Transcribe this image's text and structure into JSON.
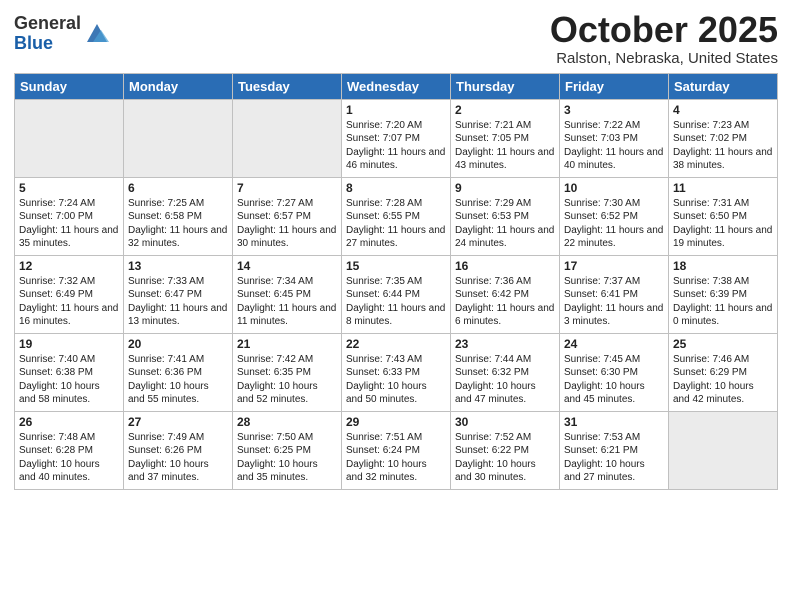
{
  "header": {
    "logo_general": "General",
    "logo_blue": "Blue",
    "month": "October 2025",
    "location": "Ralston, Nebraska, United States"
  },
  "days_of_week": [
    "Sunday",
    "Monday",
    "Tuesday",
    "Wednesday",
    "Thursday",
    "Friday",
    "Saturday"
  ],
  "weeks": [
    [
      {
        "day": "",
        "content": ""
      },
      {
        "day": "",
        "content": ""
      },
      {
        "day": "",
        "content": ""
      },
      {
        "day": "1",
        "content": "Sunrise: 7:20 AM\nSunset: 7:07 PM\nDaylight: 11 hours\nand 46 minutes."
      },
      {
        "day": "2",
        "content": "Sunrise: 7:21 AM\nSunset: 7:05 PM\nDaylight: 11 hours\nand 43 minutes."
      },
      {
        "day": "3",
        "content": "Sunrise: 7:22 AM\nSunset: 7:03 PM\nDaylight: 11 hours\nand 40 minutes."
      },
      {
        "day": "4",
        "content": "Sunrise: 7:23 AM\nSunset: 7:02 PM\nDaylight: 11 hours\nand 38 minutes."
      }
    ],
    [
      {
        "day": "5",
        "content": "Sunrise: 7:24 AM\nSunset: 7:00 PM\nDaylight: 11 hours\nand 35 minutes."
      },
      {
        "day": "6",
        "content": "Sunrise: 7:25 AM\nSunset: 6:58 PM\nDaylight: 11 hours\nand 32 minutes."
      },
      {
        "day": "7",
        "content": "Sunrise: 7:27 AM\nSunset: 6:57 PM\nDaylight: 11 hours\nand 30 minutes."
      },
      {
        "day": "8",
        "content": "Sunrise: 7:28 AM\nSunset: 6:55 PM\nDaylight: 11 hours\nand 27 minutes."
      },
      {
        "day": "9",
        "content": "Sunrise: 7:29 AM\nSunset: 6:53 PM\nDaylight: 11 hours\nand 24 minutes."
      },
      {
        "day": "10",
        "content": "Sunrise: 7:30 AM\nSunset: 6:52 PM\nDaylight: 11 hours\nand 22 minutes."
      },
      {
        "day": "11",
        "content": "Sunrise: 7:31 AM\nSunset: 6:50 PM\nDaylight: 11 hours\nand 19 minutes."
      }
    ],
    [
      {
        "day": "12",
        "content": "Sunrise: 7:32 AM\nSunset: 6:49 PM\nDaylight: 11 hours\nand 16 minutes."
      },
      {
        "day": "13",
        "content": "Sunrise: 7:33 AM\nSunset: 6:47 PM\nDaylight: 11 hours\nand 13 minutes."
      },
      {
        "day": "14",
        "content": "Sunrise: 7:34 AM\nSunset: 6:45 PM\nDaylight: 11 hours\nand 11 minutes."
      },
      {
        "day": "15",
        "content": "Sunrise: 7:35 AM\nSunset: 6:44 PM\nDaylight: 11 hours\nand 8 minutes."
      },
      {
        "day": "16",
        "content": "Sunrise: 7:36 AM\nSunset: 6:42 PM\nDaylight: 11 hours\nand 6 minutes."
      },
      {
        "day": "17",
        "content": "Sunrise: 7:37 AM\nSunset: 6:41 PM\nDaylight: 11 hours\nand 3 minutes."
      },
      {
        "day": "18",
        "content": "Sunrise: 7:38 AM\nSunset: 6:39 PM\nDaylight: 11 hours\nand 0 minutes."
      }
    ],
    [
      {
        "day": "19",
        "content": "Sunrise: 7:40 AM\nSunset: 6:38 PM\nDaylight: 10 hours\nand 58 minutes."
      },
      {
        "day": "20",
        "content": "Sunrise: 7:41 AM\nSunset: 6:36 PM\nDaylight: 10 hours\nand 55 minutes."
      },
      {
        "day": "21",
        "content": "Sunrise: 7:42 AM\nSunset: 6:35 PM\nDaylight: 10 hours\nand 52 minutes."
      },
      {
        "day": "22",
        "content": "Sunrise: 7:43 AM\nSunset: 6:33 PM\nDaylight: 10 hours\nand 50 minutes."
      },
      {
        "day": "23",
        "content": "Sunrise: 7:44 AM\nSunset: 6:32 PM\nDaylight: 10 hours\nand 47 minutes."
      },
      {
        "day": "24",
        "content": "Sunrise: 7:45 AM\nSunset: 6:30 PM\nDaylight: 10 hours\nand 45 minutes."
      },
      {
        "day": "25",
        "content": "Sunrise: 7:46 AM\nSunset: 6:29 PM\nDaylight: 10 hours\nand 42 minutes."
      }
    ],
    [
      {
        "day": "26",
        "content": "Sunrise: 7:48 AM\nSunset: 6:28 PM\nDaylight: 10 hours\nand 40 minutes."
      },
      {
        "day": "27",
        "content": "Sunrise: 7:49 AM\nSunset: 6:26 PM\nDaylight: 10 hours\nand 37 minutes."
      },
      {
        "day": "28",
        "content": "Sunrise: 7:50 AM\nSunset: 6:25 PM\nDaylight: 10 hours\nand 35 minutes."
      },
      {
        "day": "29",
        "content": "Sunrise: 7:51 AM\nSunset: 6:24 PM\nDaylight: 10 hours\nand 32 minutes."
      },
      {
        "day": "30",
        "content": "Sunrise: 7:52 AM\nSunset: 6:22 PM\nDaylight: 10 hours\nand 30 minutes."
      },
      {
        "day": "31",
        "content": "Sunrise: 7:53 AM\nSunset: 6:21 PM\nDaylight: 10 hours\nand 27 minutes."
      },
      {
        "day": "",
        "content": ""
      }
    ]
  ]
}
